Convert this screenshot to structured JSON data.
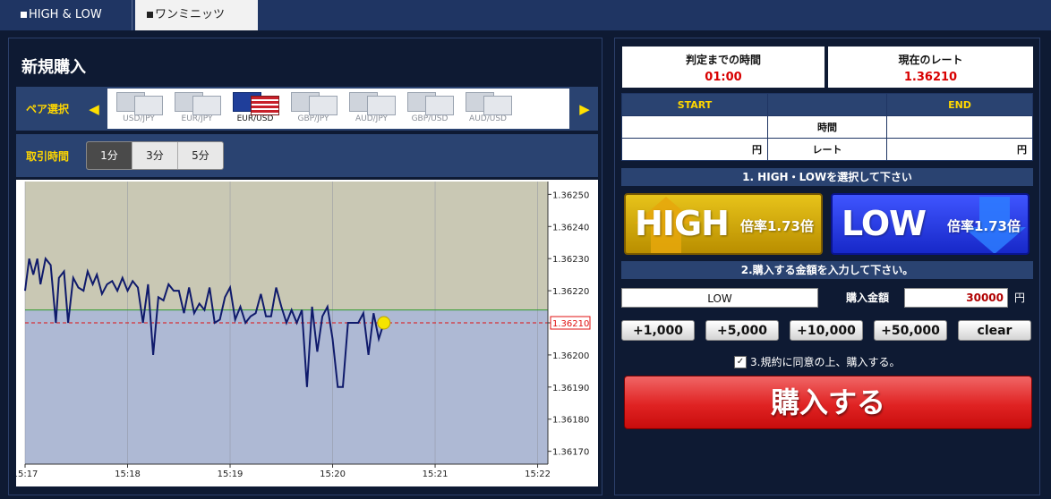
{
  "tabs": [
    {
      "label": "HIGH & LOW",
      "active": false
    },
    {
      "label": "ワンミニッツ",
      "active": true
    }
  ],
  "left": {
    "title": "新規購入",
    "pair_label": "ペア選択",
    "time_label": "取引時間",
    "prev_arrow": "◀",
    "next_arrow": "▶",
    "pairs": [
      "USD/JPY",
      "EUR/JPY",
      "EUR/USD",
      "GBP/JPY",
      "AUD/JPY",
      "GBP/USD",
      "AUD/USD"
    ],
    "selected_pair": "EUR/USD",
    "periods": [
      "1分",
      "3分",
      "5分"
    ],
    "selected_period": "1分"
  },
  "chart_data": {
    "type": "line",
    "x_ticks": [
      "15:17",
      "15:18",
      "15:19",
      "15:20",
      "15:21",
      "15:22"
    ],
    "y_ticks": [
      "1.36250",
      "1.36240",
      "1.36230",
      "1.36220",
      "1.36210",
      "1.36200",
      "1.36190",
      "1.36180",
      "1.36170"
    ],
    "ylim": [
      1.36166,
      1.36254
    ],
    "xlim": [
      0,
      5.1
    ],
    "current_rate_label": "1.36210",
    "current_rate": 1.3621,
    "reference_rate": 1.36214,
    "grid": true,
    "series": [
      {
        "x": [
          0.0,
          0.04,
          0.08,
          0.12,
          0.15,
          0.2,
          0.25,
          0.3,
          0.33,
          0.38,
          0.42,
          0.47,
          0.52,
          0.57,
          0.61,
          0.66,
          0.7,
          0.75,
          0.8,
          0.85,
          0.9,
          0.95,
          1.0,
          1.05,
          1.1,
          1.15,
          1.2,
          1.25,
          1.3,
          1.35,
          1.4,
          1.45,
          1.5,
          1.55,
          1.6,
          1.65,
          1.7,
          1.75,
          1.8,
          1.85,
          1.9,
          1.95,
          2.0,
          2.05,
          2.1,
          2.15,
          2.2,
          2.25,
          2.3,
          2.35,
          2.4,
          2.45,
          2.5,
          2.55,
          2.6,
          2.65,
          2.7,
          2.75,
          2.8,
          2.85,
          2.9,
          2.95,
          3.0,
          3.05,
          3.1,
          3.15,
          3.2,
          3.25,
          3.3,
          3.35,
          3.4,
          3.45,
          3.5
        ],
        "y": [
          1.3622,
          1.3623,
          1.36225,
          1.3623,
          1.36222,
          1.3623,
          1.36228,
          1.3621,
          1.36224,
          1.36226,
          1.3621,
          1.36224,
          1.36221,
          1.3622,
          1.36226,
          1.36222,
          1.36225,
          1.36219,
          1.36222,
          1.36223,
          1.3622,
          1.36224,
          1.3622,
          1.36223,
          1.36221,
          1.3621,
          1.36222,
          1.362,
          1.36218,
          1.36217,
          1.36222,
          1.3622,
          1.3622,
          1.36213,
          1.36221,
          1.36213,
          1.36216,
          1.36214,
          1.36221,
          1.3621,
          1.36211,
          1.36218,
          1.36221,
          1.36211,
          1.36215,
          1.3621,
          1.36212,
          1.36213,
          1.36219,
          1.36212,
          1.36212,
          1.36221,
          1.36215,
          1.3621,
          1.36214,
          1.3621,
          1.36214,
          1.3619,
          1.36215,
          1.36201,
          1.36212,
          1.36215,
          1.36205,
          1.3619,
          1.3619,
          1.3621,
          1.3621,
          1.3621,
          1.36213,
          1.362,
          1.36213,
          1.36205,
          1.3621
        ]
      }
    ]
  },
  "right": {
    "deadline_label": "判定までの時間",
    "deadline_value": "01:00",
    "rate_label": "現在のレート",
    "rate_value": "1.36210",
    "table": {
      "start": "START",
      "end": "END",
      "time_label": "時間",
      "rate_label": "レート",
      "yen": "円"
    },
    "step1": "1. HIGH・LOWを選択して下さい",
    "high": {
      "label": "HIGH",
      "rate": "倍率1.73倍"
    },
    "low": {
      "label": "LOW",
      "rate": "倍率1.73倍"
    },
    "step2": "2.購入する金額を入力して下さい。",
    "selected_direction": "LOW",
    "amount_label": "購入金額",
    "amount_value": "30000",
    "amount_unit": "円",
    "add_buttons": [
      "+1,000",
      "+5,000",
      "+10,000",
      "+50,000",
      "clear"
    ],
    "agree_text": "3.規約に同意の上、購入する。",
    "agree_check": "✓",
    "buy_label": "購入する"
  },
  "colors": {
    "panel": "#0e1a33",
    "bar": "#2a4371",
    "accent_yellow": "#ffd700",
    "rate_red": "#d80000",
    "high": "#d4ac0d",
    "low": "#2a3ee8",
    "buy": "#e02323"
  }
}
